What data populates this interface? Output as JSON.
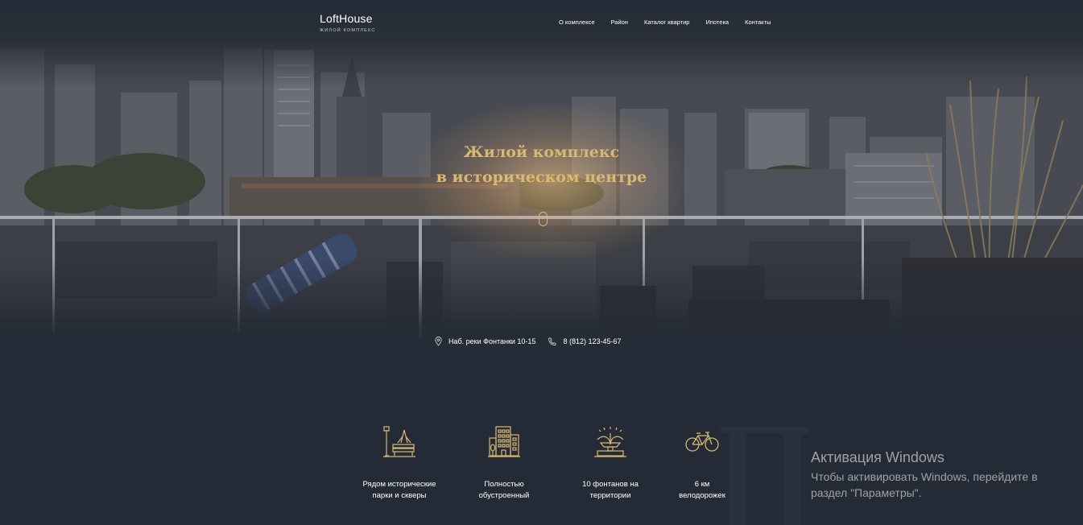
{
  "header": {
    "logo_name": "LoftHouse",
    "logo_sub": "ЖИЛОЙ КОМПЛЕКС",
    "nav": [
      "О комплексе",
      "Район",
      "Каталог квартир",
      "Ипотека",
      "Контакты"
    ]
  },
  "hero": {
    "title_line1": "Жилой комплекс",
    "title_line2": "в историческом центре",
    "address": "Наб. реки Фонтанки 10-15",
    "phone": "8 (812) 123-45-67"
  },
  "features": [
    {
      "icon": "park-bench-icon",
      "line1": "Рядом исторические",
      "line2": "парки и скверы"
    },
    {
      "icon": "buildings-icon",
      "line1": "Полностью",
      "line2": "обустроенный"
    },
    {
      "icon": "fountain-icon",
      "line1": "10 фонтанов на",
      "line2": "территории"
    },
    {
      "icon": "bicycle-icon",
      "line1": "6 км",
      "line2": "велодорожек"
    }
  ],
  "watermark": {
    "title": "Активация Windows",
    "text": "Чтобы активировать Windows, перейдите в раздел \"Параметры\"."
  },
  "colors": {
    "accent": "#d9b871",
    "background": "#252b36"
  }
}
